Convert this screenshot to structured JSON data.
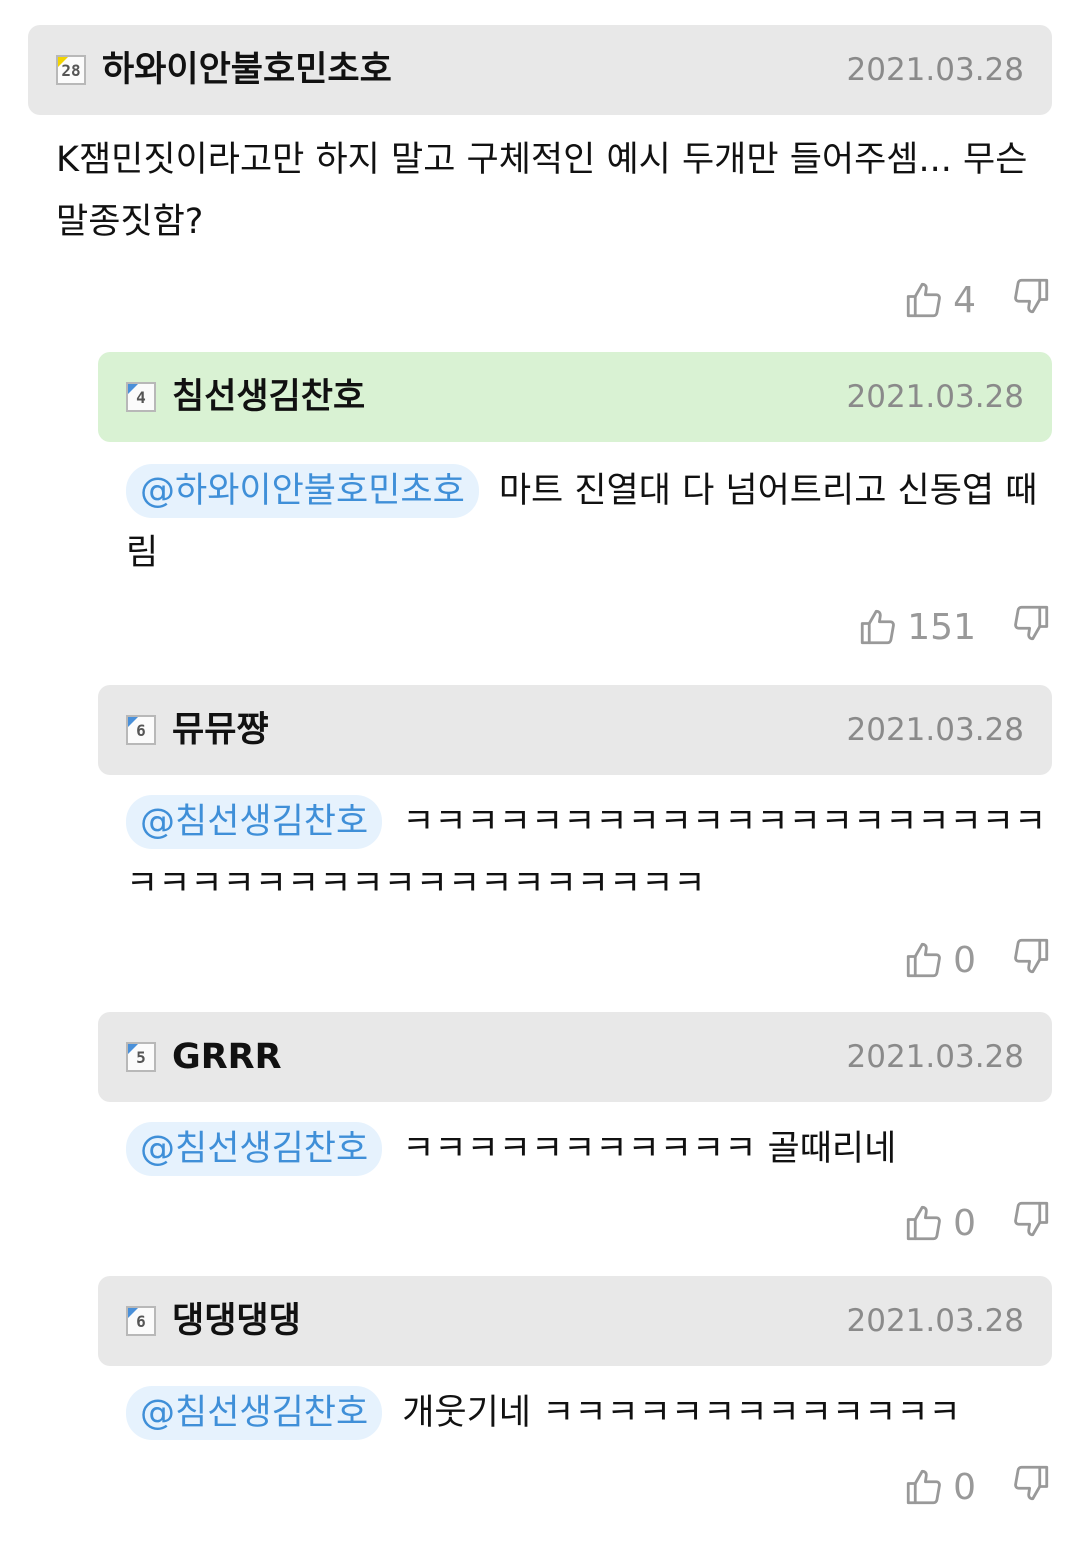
{
  "comments": [
    {
      "level": "28",
      "username": "하와이안불호민초호",
      "date": "2021.03.28",
      "text": "K잼민짓이라고만 하지 말고 구체적인 예시 두개만 들어주셈... 무슨 말종짓함?",
      "likes": "4",
      "best": false
    },
    {
      "level": "4",
      "username": "침선생김찬호",
      "date": "2021.03.28",
      "mention": "@하와이안불호민초호",
      "text": "마트 진열대 다 넘어트리고 신동엽 때림",
      "likes": "151",
      "best": true
    },
    {
      "level": "6",
      "username": "뮤뮤쨩",
      "date": "2021.03.28",
      "mention": "@침선생김찬호",
      "text": "ㅋㅋㅋㅋㅋㅋㅋㅋㅋㅋㅋㅋㅋㅋㅋㅋㅋㅋㅋㅋㅋㅋㅋㅋㅋㅋㅋㅋㅋㅋㅋㅋㅋㅋㅋㅋㅋㅋ",
      "likes": "0",
      "best": false
    },
    {
      "level": "5",
      "username": "GRRR",
      "date": "2021.03.28",
      "mention": "@침선생김찬호",
      "text": "ㅋㅋㅋㅋㅋㅋㅋㅋㅋㅋㅋ 골때리네",
      "likes": "0",
      "best": false
    },
    {
      "level": "6",
      "username": "댕댕댕댕",
      "date": "2021.03.28",
      "mention": "@침선생김찬호",
      "text": "개웃기네 ㅋㅋㅋㅋㅋㅋㅋㅋㅋㅋㅋㅋㅋ",
      "likes": "0",
      "best": false
    }
  ],
  "icons": {
    "like": "thumbs-up-icon",
    "dislike": "thumbs-down-icon"
  }
}
